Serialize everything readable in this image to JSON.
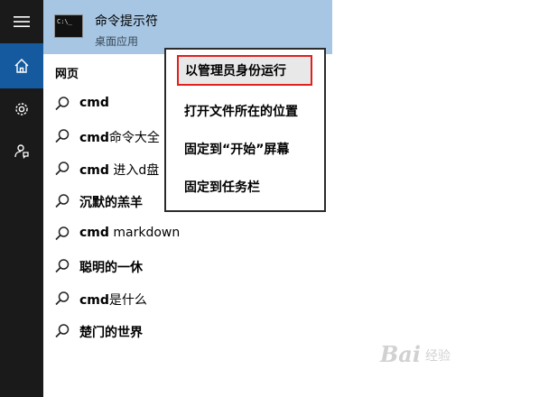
{
  "start_menu": {
    "rail": {
      "menu_icon": "hamburger-icon",
      "home_icon": "home-icon",
      "settings_icon": "gear-icon",
      "feedback_icon": "feedback-icon"
    },
    "best_match": {
      "title": "命令提示符",
      "subtitle": "桌面应用",
      "icon_label": "C:\\_"
    },
    "section_label": "网页",
    "suggestions": [
      {
        "bold": "cmd",
        "rest": ""
      },
      {
        "bold": "cmd",
        "rest": "命令大全"
      },
      {
        "bold": "cmd",
        "rest": " 进入d盘"
      },
      {
        "bold": "沉默的羔羊",
        "rest": ""
      },
      {
        "bold": "cmd",
        "rest": " markdown"
      },
      {
        "bold": "聪明的一休",
        "rest": ""
      },
      {
        "bold": "cmd",
        "rest": "是什么"
      },
      {
        "bold": "楚门的世界",
        "rest": ""
      }
    ],
    "context_menu": {
      "items": [
        "以管理员身份运行",
        "打开文件所在的位置",
        "固定到“开始”屏幕",
        "固定到任务栏"
      ]
    }
  },
  "watermark": {
    "text": "Bai",
    "sub": "经验"
  },
  "colors": {
    "rail_bg": "#1a1a1a",
    "rail_selected": "#155a9e",
    "result_highlight": "#a7c6e3",
    "context_highlight_border": "#e02020"
  }
}
